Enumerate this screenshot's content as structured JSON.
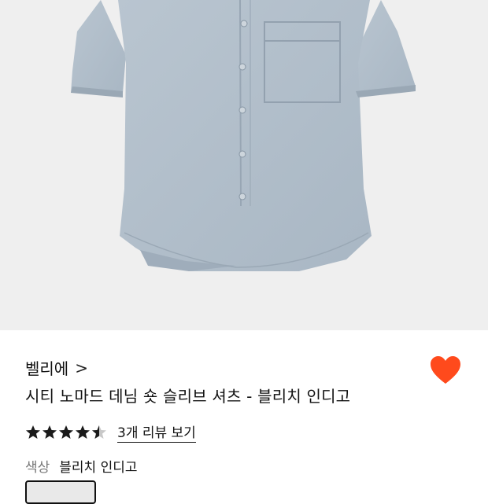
{
  "product": {
    "image_icon": "denim-short-sleeve-shirt-photo",
    "brand": "벨리에",
    "brand_chevron": ">",
    "title": "시티 노마드 데님 숏 슬리브 셔츠 - 블리치 인디고",
    "wishlist_icon": "heart-icon",
    "wishlist_color": "#ff4a1c",
    "rating": 4.5,
    "rating_max": 5,
    "review_link": "3개 리뷰 보기",
    "color_label": "색상",
    "color_value": "블리치 인디고"
  }
}
